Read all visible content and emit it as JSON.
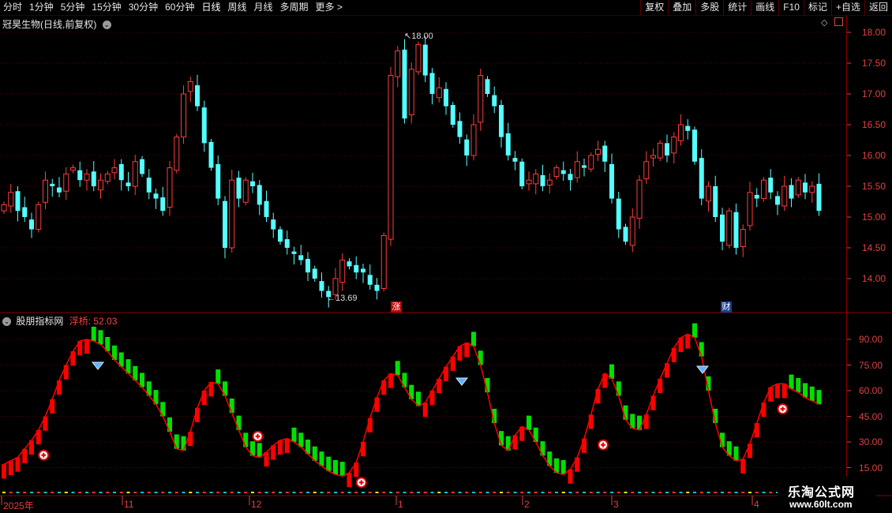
{
  "toolbar": {
    "periods": [
      "分时",
      "1分钟",
      "5分钟",
      "15分钟",
      "30分钟",
      "60分钟",
      "日线",
      "周线",
      "月线",
      "多周期",
      "更多 >"
    ],
    "active_period": "日线",
    "right_buttons": [
      "复权",
      "叠加",
      "多股",
      "统计",
      "画线",
      "F10",
      "标记",
      "+自选",
      "返回"
    ]
  },
  "main_pane": {
    "title": "冠昊生物(日线,前复权)",
    "price_axis": [
      "18.00",
      "17.50",
      "17.00",
      "16.50",
      "16.00",
      "15.50",
      "15.00",
      "14.50",
      "14.00"
    ],
    "high_label": "18.00",
    "low_label": "13.69",
    "marker_zhang": "涨",
    "marker_cai": "财"
  },
  "indicator_pane": {
    "title": "股朋指标网",
    "value_label": "浮桥: 52.03",
    "axis": [
      "90.00",
      "75.00",
      "60.00",
      "45.00",
      "30.00",
      "15.00"
    ]
  },
  "date_axis": [
    "2025年",
    "11",
    "12",
    "1",
    "2",
    "3",
    "4"
  ],
  "watermark": {
    "line1": "乐淘公式网",
    "line2": "www.60lt.com"
  },
  "colors": {
    "up": "#ff3c3c",
    "down": "#54ffff",
    "ind_up": "#ff0000",
    "ind_down": "#00e000",
    "axis": "#e04040",
    "grid": "#8b0000"
  },
  "chart_data": {
    "type": "candlestick",
    "price_ylim": [
      13.5,
      18.2
    ],
    "closes": [
      15.2,
      15.4,
      15.1,
      15.0,
      14.8,
      15.2,
      15.6,
      15.5,
      15.4,
      15.7,
      15.8,
      15.6,
      15.7,
      15.5,
      15.6,
      15.7,
      15.8,
      15.6,
      15.5,
      15.9,
      15.7,
      15.4,
      15.3,
      15.1,
      15.8,
      16.3,
      17.0,
      17.2,
      16.8,
      16.2,
      15.8,
      15.3,
      14.5,
      15.6,
      15.3,
      15.6,
      15.5,
      15.2,
      15.0,
      14.8,
      14.6,
      14.5,
      14.4,
      14.3,
      14.1,
      14.0,
      13.8,
      13.7,
      14.0,
      14.3,
      14.2,
      14.1,
      14.1,
      13.9,
      13.8,
      14.7,
      17.3,
      17.7,
      16.6,
      17.4,
      17.8,
      17.3,
      17.0,
      17.1,
      16.8,
      16.5,
      16.3,
      16.0,
      16.5,
      17.3,
      17.0,
      16.8,
      16.3,
      16.0,
      15.9,
      15.5,
      15.6,
      15.7,
      15.5,
      15.6,
      15.8,
      15.7,
      15.6,
      15.9,
      15.8,
      16.0,
      16.1,
      15.9,
      15.3,
      14.8,
      14.6,
      15.0,
      15.6,
      15.9,
      16.0,
      16.2,
      16.0,
      16.3,
      16.5,
      16.4,
      15.9,
      15.3,
      15.5,
      15.0,
      14.6,
      15.1,
      14.5,
      14.8,
      15.4,
      15.3,
      15.6,
      15.4,
      15.2,
      15.5,
      15.3,
      15.6,
      15.4,
      15.5,
      15.1
    ],
    "oscillator": [
      17,
      19,
      21,
      26,
      31,
      37,
      45,
      55,
      66,
      75,
      83,
      89,
      90,
      89,
      87,
      83,
      78,
      74,
      70,
      66,
      62,
      57,
      52,
      45,
      36,
      26,
      25,
      36,
      50,
      60,
      65,
      64,
      57,
      47,
      37,
      27,
      22,
      21,
      24,
      28,
      31,
      32,
      30,
      27,
      23,
      19,
      16,
      13,
      11,
      10,
      12,
      18,
      30,
      44,
      56,
      66,
      70,
      69,
      62,
      55,
      51,
      53,
      60,
      67,
      74,
      80,
      86,
      88,
      86,
      75,
      59,
      41,
      28,
      25,
      34,
      39,
      37,
      30,
      22,
      16,
      12,
      11,
      14,
      21,
      32,
      46,
      61,
      70,
      67,
      57,
      43,
      38,
      37,
      46,
      57,
      67,
      76,
      85,
      91,
      93,
      91,
      80,
      60,
      41,
      27,
      22,
      19,
      20,
      29,
      41,
      53,
      62,
      64,
      64,
      61,
      59,
      56,
      54,
      52
    ]
  }
}
